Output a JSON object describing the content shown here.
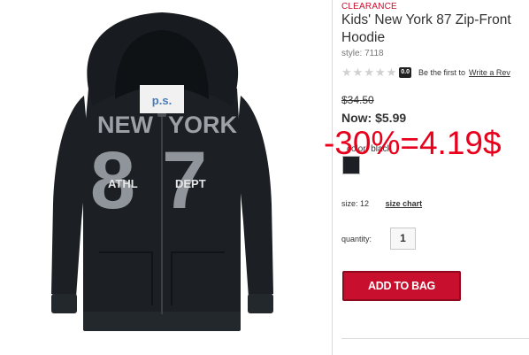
{
  "product": {
    "badge": "CLEARANCE",
    "title": "Kids' New York 87 Zip-Front Hoodie",
    "style": "style: 7118",
    "rating": {
      "score": "0.0",
      "first_text": "Be the first to",
      "write_link": "Write a Rev"
    },
    "old_price": "$34.50",
    "now_price": "Now: $5.99",
    "color_label": "color: black",
    "swatch_color": "#1c2024",
    "overlay_text": "-30%=4.19$",
    "size_label": "size:",
    "size_value": "12",
    "size_chart": "size chart",
    "quantity_label": "quantity:",
    "quantity_value": "1",
    "add_to_bag": "ADD TO BAG"
  },
  "image": {
    "tag_text": "p.s.",
    "graphic_new": "NEW",
    "graphic_york": "YORK",
    "graphic_number": "87",
    "graphic_athl": "ATHL",
    "graphic_dept": "DEPT"
  },
  "colors": {
    "brand_red": "#c8102e",
    "hoodie": "#1c2024",
    "print_gray": "#9ba1a6"
  }
}
